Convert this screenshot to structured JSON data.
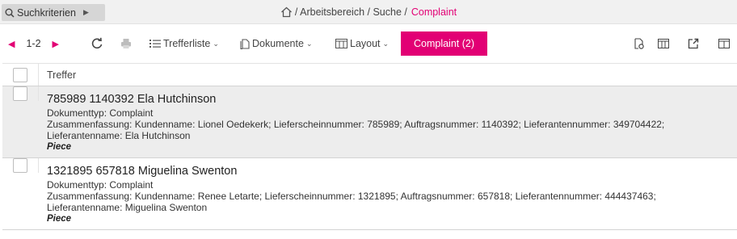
{
  "topbar": {
    "search_toggle_label": "Suchkriterien",
    "breadcrumb_path": "/ Arbeitsbereich / Suche /",
    "breadcrumb_current": "Complaint"
  },
  "toolbar": {
    "page_range": "1-2",
    "trefferliste_label": "Trefferliste",
    "dokumente_label": "Dokumente",
    "layout_label": "Layout",
    "active_tab_label": "Complaint (2)"
  },
  "table": {
    "header_label": "Treffer",
    "rows": [
      {
        "headline": "785989 1140392 Ela Hutchinson",
        "doctype": "Dokumenttyp: Complaint",
        "summary": "Zusammenfassung: Kundenname: Lionel Oedekerk; Lieferscheinnummer: 785989; Auftragsnummer: 1140392; Lieferantennummer: 349704422;",
        "supplier": "Lieferantenname: Ela Hutchinson",
        "tag": "Piece"
      },
      {
        "headline": "1321895 657818 Miguelina Swenton",
        "doctype": "Dokumenttyp: Complaint",
        "summary": "Zusammenfassung: Kundenname: Renee Letarte; Lieferscheinnummer: 1321895; Auftragsnummer: 657818; Lieferantennummer: 444437463;",
        "supplier": "Lieferantenname: Miguelina Swenton",
        "tag": "Piece"
      }
    ]
  },
  "colors": {
    "accent": "#e20074",
    "selected_row": "#ededed"
  }
}
